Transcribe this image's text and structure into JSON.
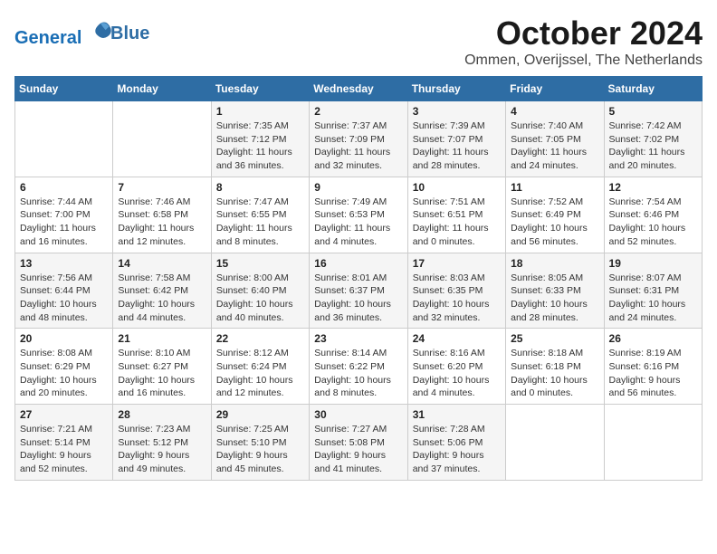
{
  "header": {
    "logo_line1": "General",
    "logo_line2": "Blue",
    "title": "October 2024",
    "subtitle": "Ommen, Overijssel, The Netherlands"
  },
  "days_of_week": [
    "Sunday",
    "Monday",
    "Tuesday",
    "Wednesday",
    "Thursday",
    "Friday",
    "Saturday"
  ],
  "weeks": [
    [
      {
        "day": "",
        "info": ""
      },
      {
        "day": "",
        "info": ""
      },
      {
        "day": "1",
        "info": "Sunrise: 7:35 AM\nSunset: 7:12 PM\nDaylight: 11 hours and 36 minutes."
      },
      {
        "day": "2",
        "info": "Sunrise: 7:37 AM\nSunset: 7:09 PM\nDaylight: 11 hours and 32 minutes."
      },
      {
        "day": "3",
        "info": "Sunrise: 7:39 AM\nSunset: 7:07 PM\nDaylight: 11 hours and 28 minutes."
      },
      {
        "day": "4",
        "info": "Sunrise: 7:40 AM\nSunset: 7:05 PM\nDaylight: 11 hours and 24 minutes."
      },
      {
        "day": "5",
        "info": "Sunrise: 7:42 AM\nSunset: 7:02 PM\nDaylight: 11 hours and 20 minutes."
      }
    ],
    [
      {
        "day": "6",
        "info": "Sunrise: 7:44 AM\nSunset: 7:00 PM\nDaylight: 11 hours and 16 minutes."
      },
      {
        "day": "7",
        "info": "Sunrise: 7:46 AM\nSunset: 6:58 PM\nDaylight: 11 hours and 12 minutes."
      },
      {
        "day": "8",
        "info": "Sunrise: 7:47 AM\nSunset: 6:55 PM\nDaylight: 11 hours and 8 minutes."
      },
      {
        "day": "9",
        "info": "Sunrise: 7:49 AM\nSunset: 6:53 PM\nDaylight: 11 hours and 4 minutes."
      },
      {
        "day": "10",
        "info": "Sunrise: 7:51 AM\nSunset: 6:51 PM\nDaylight: 11 hours and 0 minutes."
      },
      {
        "day": "11",
        "info": "Sunrise: 7:52 AM\nSunset: 6:49 PM\nDaylight: 10 hours and 56 minutes."
      },
      {
        "day": "12",
        "info": "Sunrise: 7:54 AM\nSunset: 6:46 PM\nDaylight: 10 hours and 52 minutes."
      }
    ],
    [
      {
        "day": "13",
        "info": "Sunrise: 7:56 AM\nSunset: 6:44 PM\nDaylight: 10 hours and 48 minutes."
      },
      {
        "day": "14",
        "info": "Sunrise: 7:58 AM\nSunset: 6:42 PM\nDaylight: 10 hours and 44 minutes."
      },
      {
        "day": "15",
        "info": "Sunrise: 8:00 AM\nSunset: 6:40 PM\nDaylight: 10 hours and 40 minutes."
      },
      {
        "day": "16",
        "info": "Sunrise: 8:01 AM\nSunset: 6:37 PM\nDaylight: 10 hours and 36 minutes."
      },
      {
        "day": "17",
        "info": "Sunrise: 8:03 AM\nSunset: 6:35 PM\nDaylight: 10 hours and 32 minutes."
      },
      {
        "day": "18",
        "info": "Sunrise: 8:05 AM\nSunset: 6:33 PM\nDaylight: 10 hours and 28 minutes."
      },
      {
        "day": "19",
        "info": "Sunrise: 8:07 AM\nSunset: 6:31 PM\nDaylight: 10 hours and 24 minutes."
      }
    ],
    [
      {
        "day": "20",
        "info": "Sunrise: 8:08 AM\nSunset: 6:29 PM\nDaylight: 10 hours and 20 minutes."
      },
      {
        "day": "21",
        "info": "Sunrise: 8:10 AM\nSunset: 6:27 PM\nDaylight: 10 hours and 16 minutes."
      },
      {
        "day": "22",
        "info": "Sunrise: 8:12 AM\nSunset: 6:24 PM\nDaylight: 10 hours and 12 minutes."
      },
      {
        "day": "23",
        "info": "Sunrise: 8:14 AM\nSunset: 6:22 PM\nDaylight: 10 hours and 8 minutes."
      },
      {
        "day": "24",
        "info": "Sunrise: 8:16 AM\nSunset: 6:20 PM\nDaylight: 10 hours and 4 minutes."
      },
      {
        "day": "25",
        "info": "Sunrise: 8:18 AM\nSunset: 6:18 PM\nDaylight: 10 hours and 0 minutes."
      },
      {
        "day": "26",
        "info": "Sunrise: 8:19 AM\nSunset: 6:16 PM\nDaylight: 9 hours and 56 minutes."
      }
    ],
    [
      {
        "day": "27",
        "info": "Sunrise: 7:21 AM\nSunset: 5:14 PM\nDaylight: 9 hours and 52 minutes."
      },
      {
        "day": "28",
        "info": "Sunrise: 7:23 AM\nSunset: 5:12 PM\nDaylight: 9 hours and 49 minutes."
      },
      {
        "day": "29",
        "info": "Sunrise: 7:25 AM\nSunset: 5:10 PM\nDaylight: 9 hours and 45 minutes."
      },
      {
        "day": "30",
        "info": "Sunrise: 7:27 AM\nSunset: 5:08 PM\nDaylight: 9 hours and 41 minutes."
      },
      {
        "day": "31",
        "info": "Sunrise: 7:28 AM\nSunset: 5:06 PM\nDaylight: 9 hours and 37 minutes."
      },
      {
        "day": "",
        "info": ""
      },
      {
        "day": "",
        "info": ""
      }
    ]
  ]
}
